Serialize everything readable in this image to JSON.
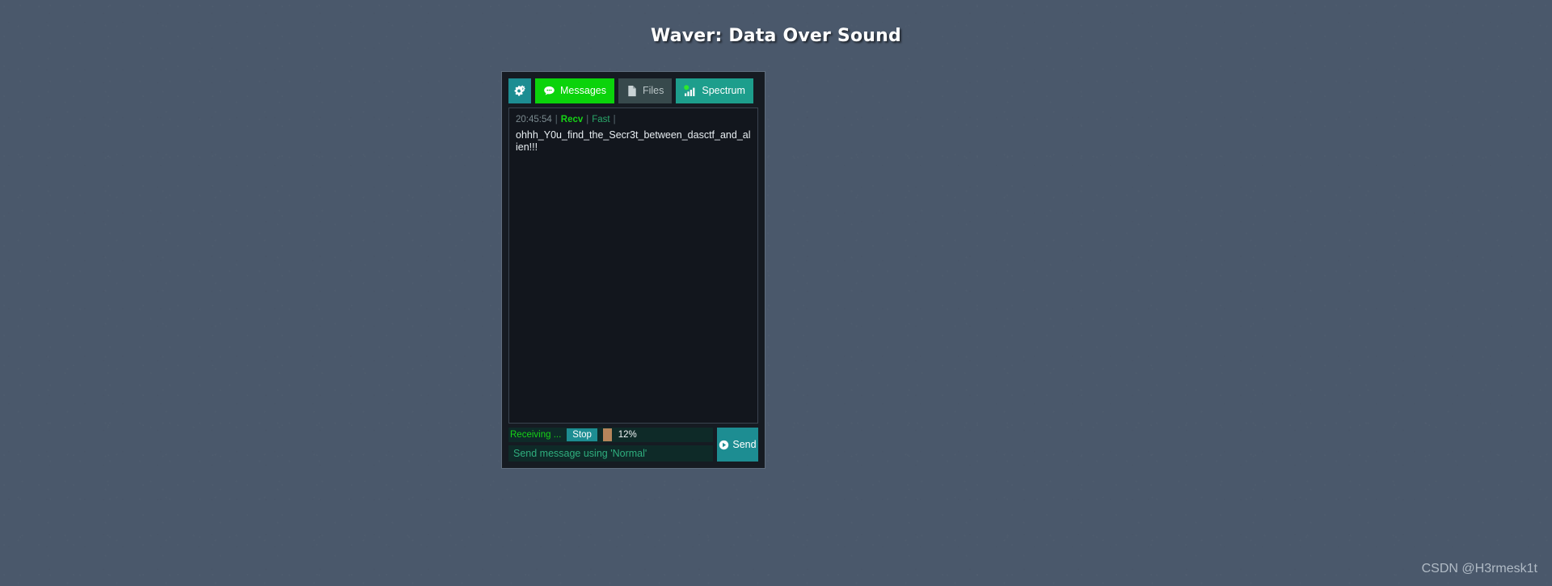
{
  "page": {
    "title": "Waver: Data Over Sound",
    "background_color": "#4a586b",
    "watermark": "CSDN @H3rmesk1t"
  },
  "window": {
    "background_color": "#161b22",
    "border_color": "#5f6d7e"
  },
  "toolbar": {
    "buttons": [
      {
        "label": "",
        "icon": "gears-icon",
        "color": "#1d8d92",
        "active": false
      },
      {
        "label": "Messages",
        "icon": "chat-bubble-icon",
        "color": "#0bd30b",
        "active": true
      },
      {
        "label": "Files",
        "icon": "file-page-icon",
        "color": "#37494c",
        "active": false
      },
      {
        "label": "Spectrum",
        "icon": "signal-bars-icon",
        "color": "#1d9e8c",
        "active": false
      }
    ]
  },
  "messages": {
    "items": [
      {
        "time": "20:45:54",
        "direction": "Recv",
        "protocol": "Fast",
        "separator": "|",
        "body": "ohhh_Y0u_find_the_Secr3t_between_dasctf_and_alien!!!"
      }
    ],
    "time_color": "#7b8a8f",
    "direction_color": "#16d316",
    "protocol_color": "#2aa86a"
  },
  "status": {
    "label": "Receiving ...",
    "label_color": "#16d316",
    "stop_label": "Stop",
    "progress_percent": 12,
    "progress_percent_label": "12%",
    "progress_fill_color": "#b5855b"
  },
  "composer": {
    "value": "",
    "placeholder": "Send message using 'Normal'",
    "send_label": "Send",
    "send_icon": "play-circle-icon"
  }
}
